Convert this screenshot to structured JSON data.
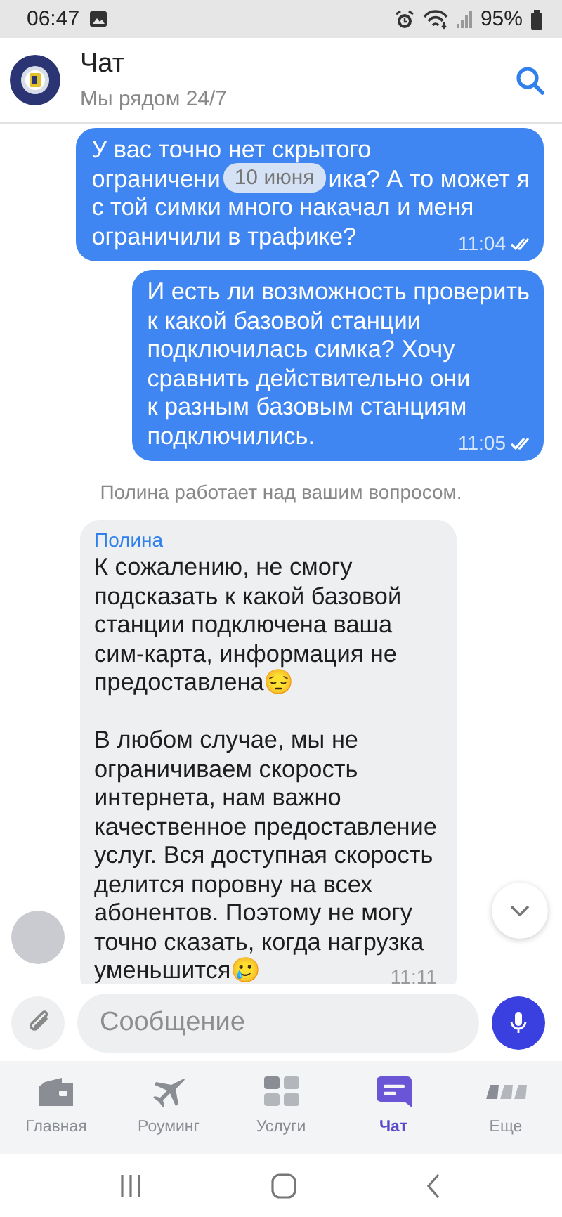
{
  "status_bar": {
    "time": "06:47",
    "battery": "95%"
  },
  "header": {
    "title": "Чат",
    "subtitle": "Мы рядом 24/7"
  },
  "date_pill": "10 июня",
  "messages": [
    {
      "kind": "outgoing",
      "time": "11:04",
      "read": true,
      "paragraphs": [
        [
          {
            "segments": [
              "У вас точно нет скрытого"
            ]
          },
          {
            "segments": [
              "ограничени",
              "ика? А то может я"
            ]
          },
          {
            "segments": [
              "с той симки много накачал и меня"
            ]
          },
          {
            "segments": [
              "ограничили в трафике?"
            ]
          }
        ]
      ]
    },
    {
      "kind": "outgoing",
      "time": "11:05",
      "read": true,
      "paragraphs": [
        [
          {
            "segments": [
              "И есть ли возможность проверить"
            ]
          },
          {
            "segments": [
              "к какой базовой станции"
            ]
          },
          {
            "segments": [
              "подключилась симка? Хочу"
            ]
          },
          {
            "segments": [
              "сравнить действительно они"
            ]
          },
          {
            "segments": [
              "к разным базовым станциям"
            ]
          },
          {
            "segments": [
              "подключились."
            ]
          }
        ]
      ]
    },
    {
      "kind": "system",
      "text": "Полина работает над вашим вопросом."
    },
    {
      "kind": "incoming",
      "author": "Полина",
      "time": "11:11",
      "paragraphs": [
        [
          {
            "segments": [
              "К сожалению, не смогу"
            ]
          },
          {
            "segments": [
              "подсказать к какой базовой"
            ]
          },
          {
            "segments": [
              "станции подключена ваша"
            ]
          },
          {
            "segments": [
              "сим-карта, информация не"
            ]
          },
          {
            "segments": [
              "предоставлена😔"
            ]
          }
        ],
        [
          {
            "segments": [
              "В любом случае, мы не"
            ]
          },
          {
            "segments": [
              "ограничиваем скорость"
            ]
          },
          {
            "segments": [
              "интернета, нам важно"
            ]
          },
          {
            "segments": [
              "качественное предоставление"
            ]
          },
          {
            "segments": [
              "услуг. Вся доступная скорость"
            ]
          },
          {
            "segments": [
              "делится поровну на всех"
            ]
          },
          {
            "segments": [
              "абонентов. Поэтому не могу"
            ]
          },
          {
            "segments": [
              "точно сказать, когда нагрузка"
            ]
          },
          {
            "segments": [
              "уменьшится🥲"
            ]
          }
        ]
      ]
    }
  ],
  "composer": {
    "placeholder": "Сообщение"
  },
  "tabs": [
    {
      "label": "Главная",
      "selected": false
    },
    {
      "label": "Роуминг",
      "selected": false
    },
    {
      "label": "Услуги",
      "selected": false
    },
    {
      "label": "Чат",
      "selected": true
    },
    {
      "label": "Еще",
      "selected": false
    }
  ]
}
